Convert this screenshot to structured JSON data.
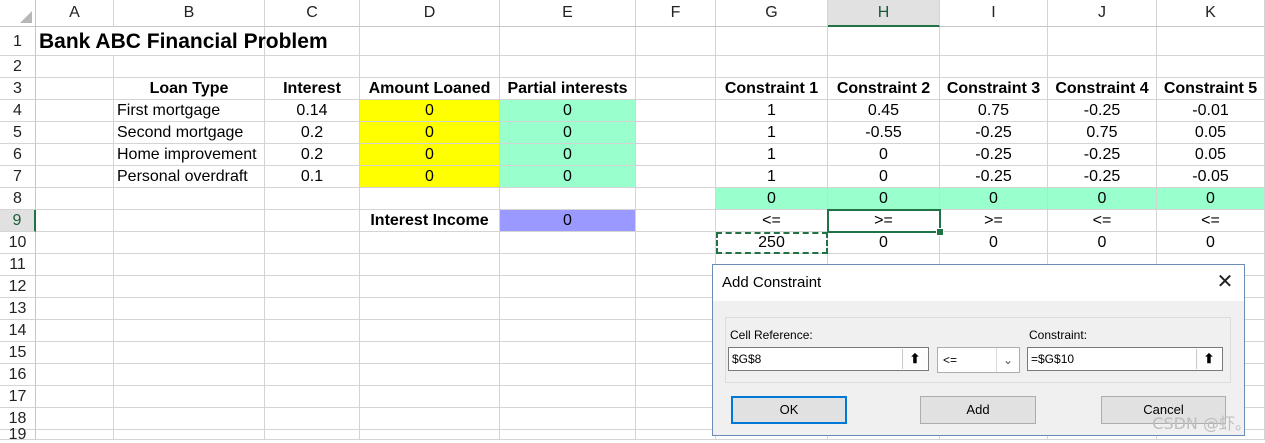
{
  "columns": [
    "A",
    "B",
    "C",
    "D",
    "E",
    "F",
    "G",
    "H",
    "I",
    "J",
    "K"
  ],
  "rows": [
    "1",
    "2",
    "3",
    "4",
    "5",
    "6",
    "7",
    "8",
    "9",
    "10",
    "11",
    "12",
    "13",
    "14",
    "15",
    "16",
    "17",
    "18",
    "19"
  ],
  "sheet": {
    "title": "Bank ABC Financial Problem",
    "headers": {
      "loan_type": "Loan Type",
      "interest": "Interest",
      "amount_loaned": "Amount Loaned",
      "partial_interests": "Partial interests"
    },
    "loans": [
      {
        "type": "First mortgage",
        "interest": "0.14",
        "amount": "0",
        "partial": "0"
      },
      {
        "type": "Second mortgage",
        "interest": "0.2",
        "amount": "0",
        "partial": "0"
      },
      {
        "type": "Home improvement",
        "interest": "0.2",
        "amount": "0",
        "partial": "0"
      },
      {
        "type": "Personal overdraft",
        "interest": "0.1",
        "amount": "0",
        "partial": "0"
      }
    ],
    "interest_income_label": "Interest Income",
    "interest_income_value": "0",
    "constraint_headers": [
      "Constraint 1",
      "Constraint 2",
      "Constraint 3",
      "Constraint 4",
      "Constraint 5"
    ],
    "constraint_rows": [
      [
        "1",
        "0.45",
        "0.75",
        "-0.25",
        "-0.01"
      ],
      [
        "1",
        "-0.55",
        "-0.25",
        "0.75",
        "0.05"
      ],
      [
        "1",
        "0",
        "-0.25",
        "-0.25",
        "0.05"
      ],
      [
        "1",
        "0",
        "-0.25",
        "-0.25",
        "-0.05"
      ]
    ],
    "constraint_totals": [
      "0",
      "0",
      "0",
      "0",
      "0"
    ],
    "constraint_signs": [
      "<=",
      ">=",
      ">=",
      "<=",
      "<="
    ],
    "constraint_rhs": [
      "250",
      "0",
      "0",
      "0",
      "0"
    ]
  },
  "dialog": {
    "title": "Add Constraint",
    "cell_reference_label": "Cell Reference:",
    "cell_reference_value": "$G$8",
    "operator_value": "<=",
    "constraint_label": "Constraint:",
    "constraint_value": "=$G$10",
    "ok_label": "OK",
    "add_label": "Add",
    "cancel_label": "Cancel"
  },
  "watermark": "CSDN @虾。",
  "colors": {
    "yellow": "#ffff00",
    "mint": "#99ffcc",
    "lavender": "#9999ff",
    "excel_green": "#217346",
    "dialog_border": "#0078d7"
  }
}
